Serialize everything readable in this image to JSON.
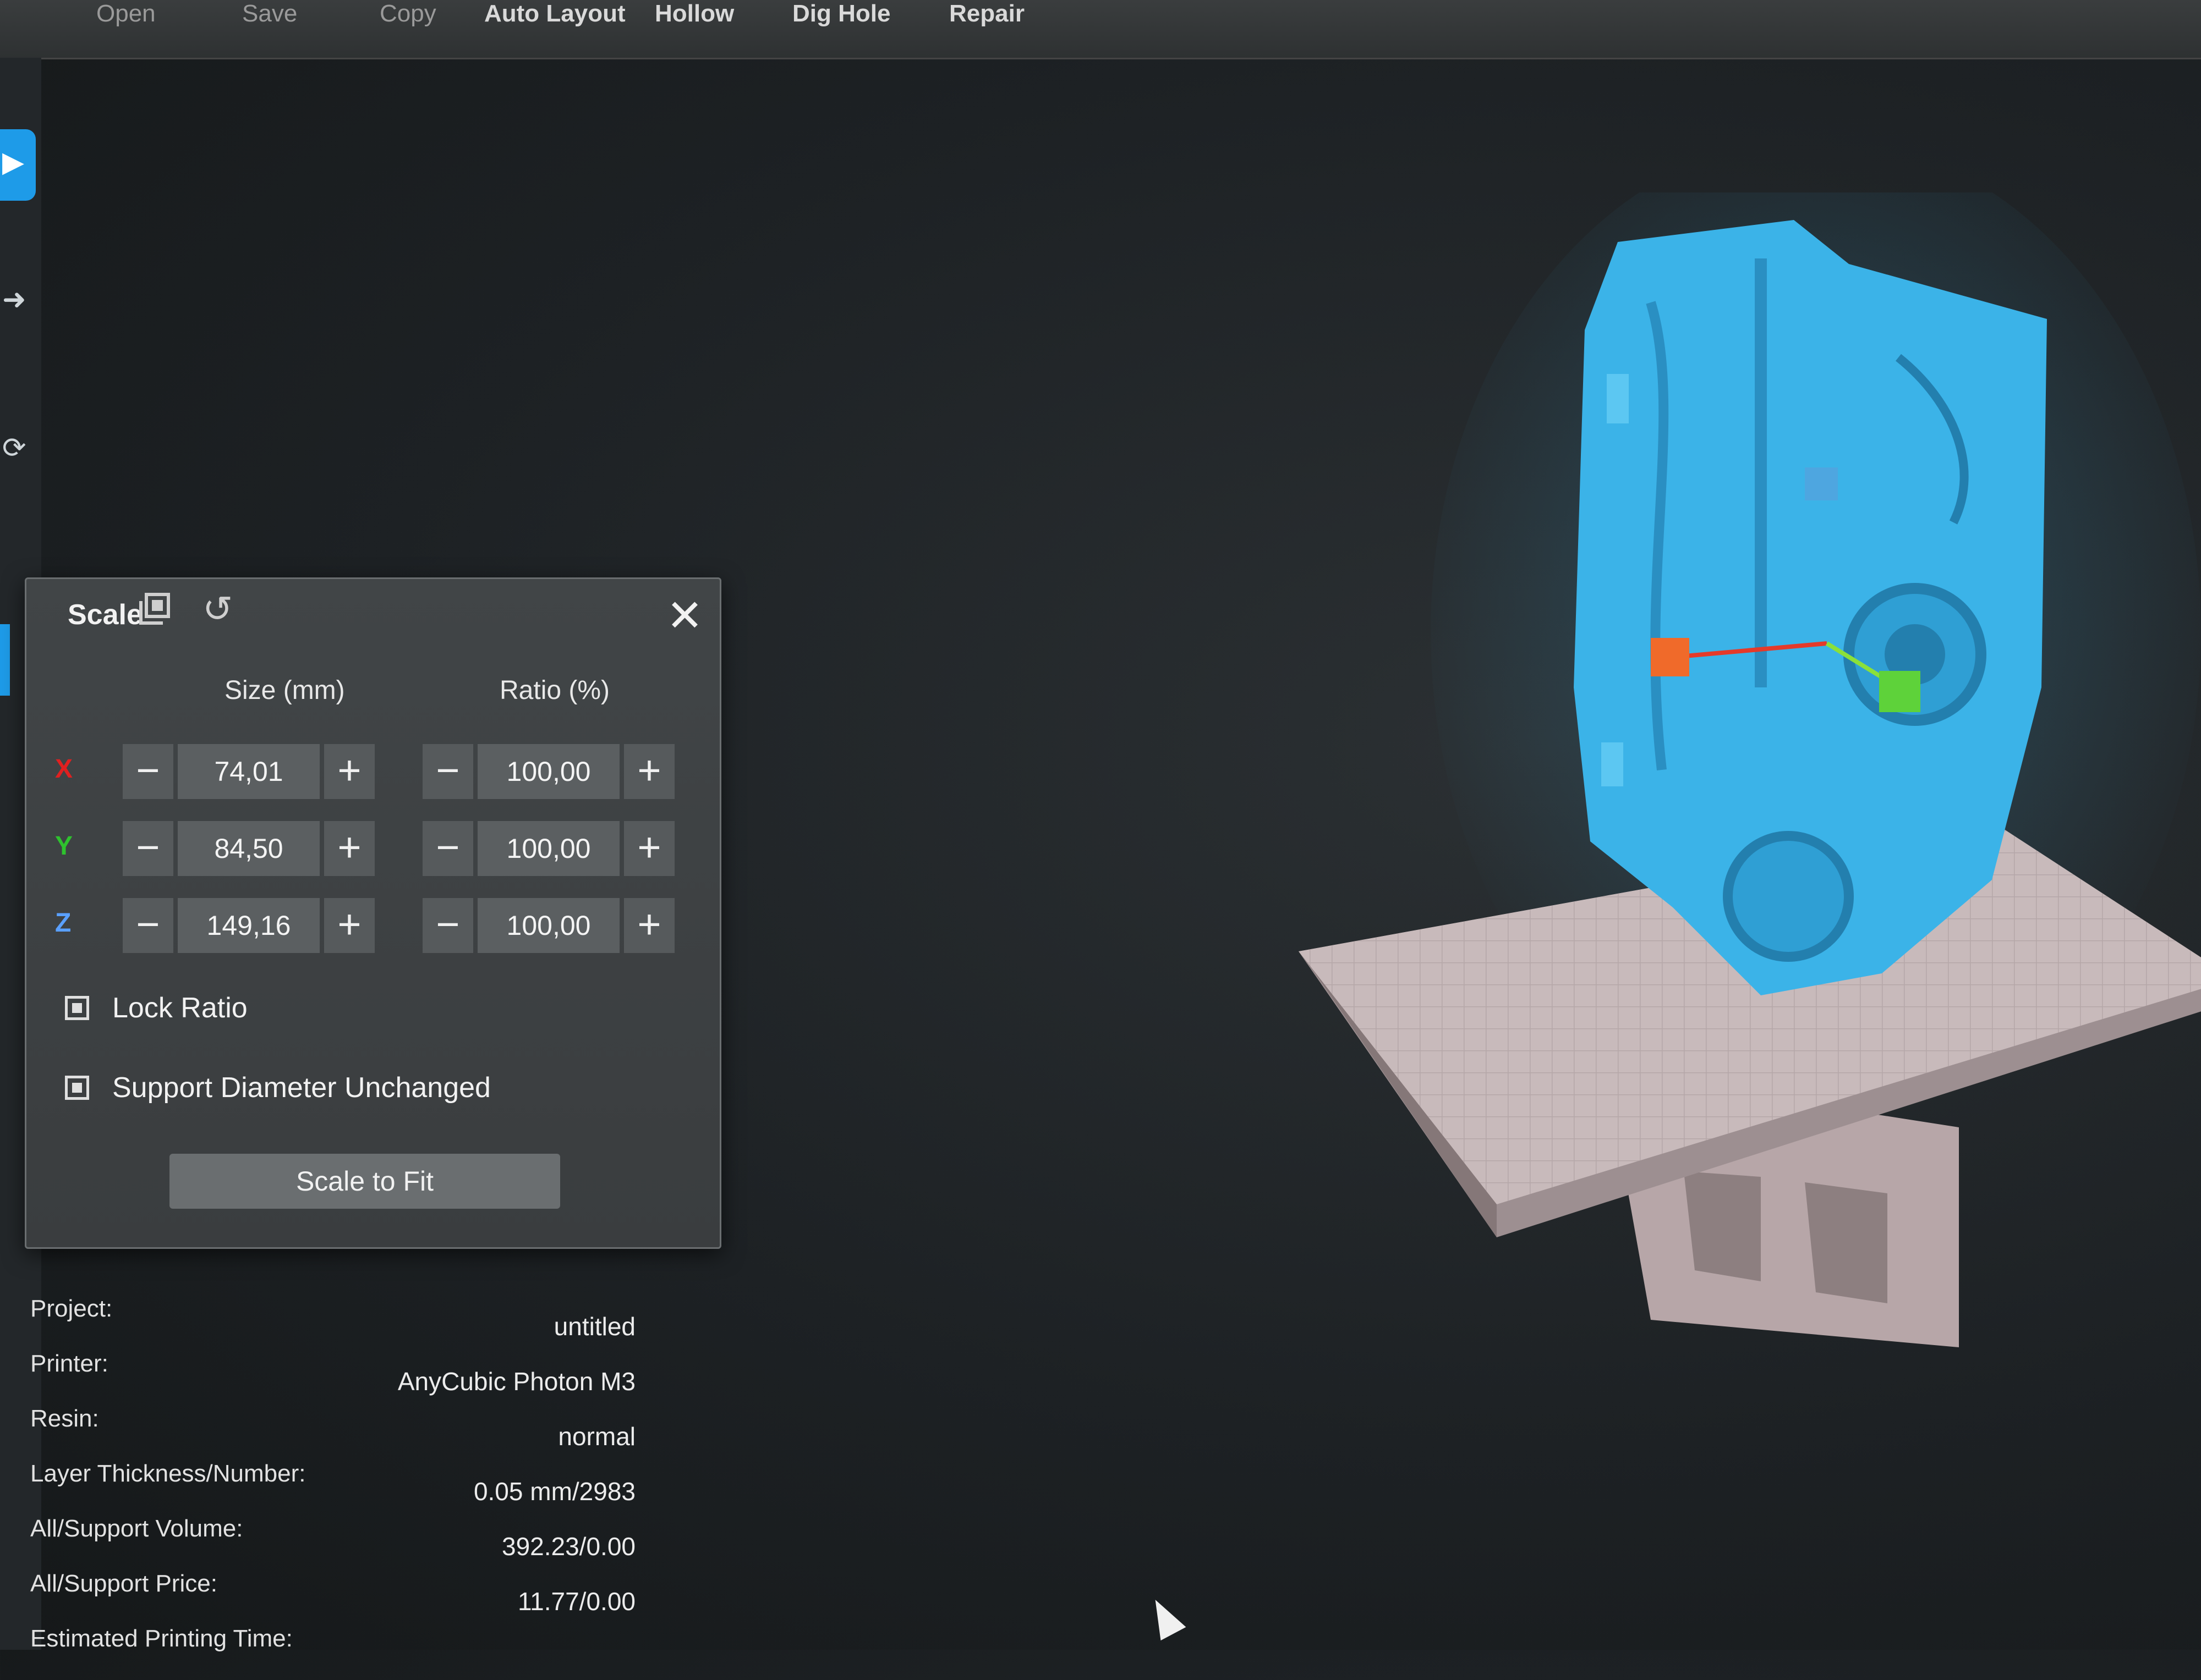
{
  "toolbar": {
    "items": [
      "Open",
      "Save",
      "Copy",
      "Auto Layout",
      "Hollow",
      "Dig Hole",
      "Repair"
    ]
  },
  "scale_panel": {
    "title": "Scale",
    "icons": [
      "copy-layers-icon",
      "reset-icon",
      "close-icon"
    ],
    "size_header": "Size (mm)",
    "ratio_header": "Ratio (%)",
    "rows": [
      {
        "axis": "X",
        "axis_color": "#e02020",
        "size": "74,01",
        "ratio": "100,00"
      },
      {
        "axis": "Y",
        "axis_color": "#2ec22e",
        "size": "84,50",
        "ratio": "100,00"
      },
      {
        "axis": "Z",
        "axis_color": "#5aa0ff",
        "size": "149,16",
        "ratio": "100,00"
      }
    ],
    "lock_ratio": "Lock Ratio",
    "support_diameter": "Support Diameter Unchanged",
    "scale_to_fit": "Scale to Fit"
  },
  "info": {
    "rows": [
      {
        "label": "Project:",
        "value": "untitled"
      },
      {
        "label": "Printer:",
        "value": "AnyCubic Photon M3"
      },
      {
        "label": "Resin:",
        "value": "normal"
      },
      {
        "label": "Layer Thickness/Number:",
        "value": "0.05 mm/2983"
      },
      {
        "label": "All/Support Volume:",
        "value": "392.23/0.00"
      },
      {
        "label": "All/Support Price:",
        "value": "11.77/0.00"
      },
      {
        "label": "Estimated Printing Time:",
        "value": ""
      }
    ]
  },
  "colors": {
    "model": "#3bb3e8",
    "plate": "#bdaeb0",
    "accent": "#1e9be8"
  }
}
